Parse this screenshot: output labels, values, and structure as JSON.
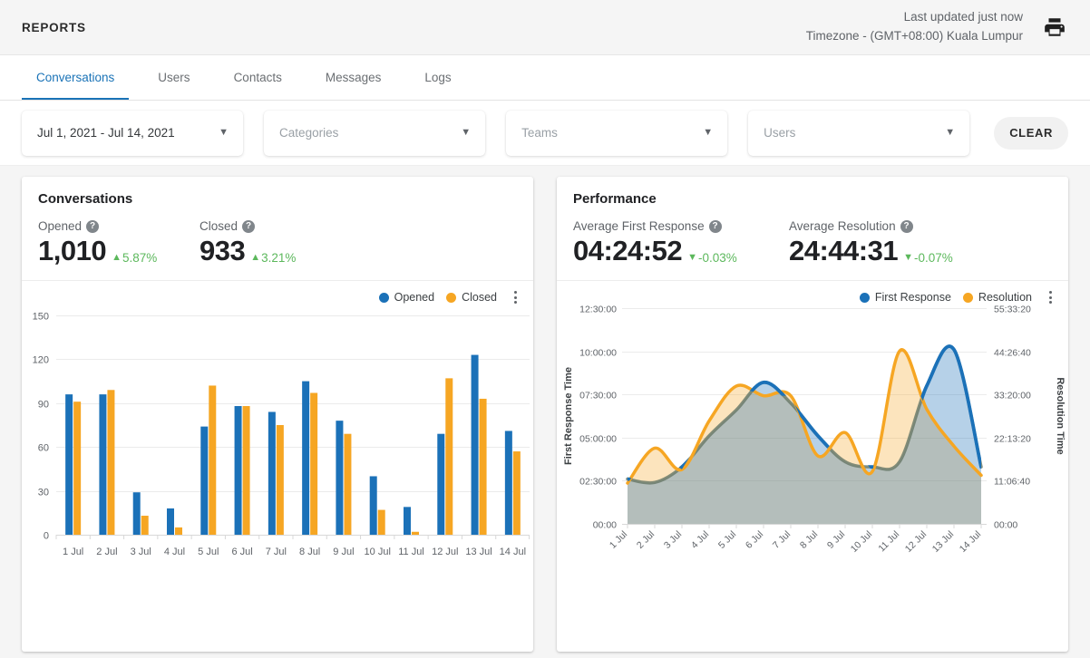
{
  "header": {
    "title": "REPORTS",
    "last_updated": "Last updated just now",
    "timezone": "Timezone - (GMT+08:00) Kuala Lumpur",
    "print_icon": "print-icon"
  },
  "tabs": [
    {
      "label": "Conversations",
      "active": true
    },
    {
      "label": "Users",
      "active": false
    },
    {
      "label": "Contacts",
      "active": false
    },
    {
      "label": "Messages",
      "active": false
    },
    {
      "label": "Logs",
      "active": false
    }
  ],
  "filters": {
    "date_range": "Jul 1, 2021 - Jul 14, 2021",
    "categories_placeholder": "Categories",
    "teams_placeholder": "Teams",
    "users_placeholder": "Users",
    "clear_label": "CLEAR",
    "chevron": "chevron-down-icon"
  },
  "conversations_card": {
    "title": "Conversations",
    "stats": [
      {
        "label": "Opened",
        "value": "1,010",
        "delta": "5.87%",
        "direction": "up"
      },
      {
        "label": "Closed",
        "value": "933",
        "delta": "3.21%",
        "direction": "up"
      }
    ],
    "legend": [
      {
        "label": "Opened",
        "color": "#1b71b8"
      },
      {
        "label": "Closed",
        "color": "#f6a623"
      }
    ]
  },
  "performance_card": {
    "title": "Performance",
    "stats": [
      {
        "label": "Average First Response",
        "value": "04:24:52",
        "delta": "-0.03%",
        "direction": "down"
      },
      {
        "label": "Average Resolution",
        "value": "24:44:31",
        "delta": "-0.07%",
        "direction": "down"
      }
    ],
    "legend": [
      {
        "label": "First Response",
        "color": "#1b71b8"
      },
      {
        "label": "Resolution",
        "color": "#f6a623"
      }
    ]
  },
  "chart_data": [
    {
      "type": "bar",
      "title": "Conversations",
      "categories": [
        "1 Jul",
        "2 Jul",
        "3 Jul",
        "4 Jul",
        "5 Jul",
        "6 Jul",
        "7 Jul",
        "8 Jul",
        "9 Jul",
        "10 Jul",
        "11 Jul",
        "12 Jul",
        "13 Jul",
        "14 Jul"
      ],
      "series": [
        {
          "name": "Opened",
          "color": "#1b71b8",
          "values": [
            96,
            96,
            29,
            18,
            74,
            88,
            84,
            105,
            78,
            40,
            19,
            69,
            123,
            71
          ]
        },
        {
          "name": "Closed",
          "color": "#f6a623",
          "values": [
            91,
            99,
            13,
            5,
            102,
            88,
            75,
            97,
            69,
            17,
            2,
            107,
            93,
            57
          ]
        }
      ],
      "xlabel": "",
      "ylabel": "",
      "ylim": [
        0,
        150
      ],
      "yticks": [
        "0",
        "30",
        "60",
        "90",
        "120",
        "150"
      ],
      "grid": true,
      "legend_position": "top-right"
    },
    {
      "type": "area",
      "title": "Performance",
      "categories": [
        "1 Jul",
        "2 Jul",
        "3 Jul",
        "4 Jul",
        "5 Jul",
        "6 Jul",
        "7 Jul",
        "8 Jul",
        "9 Jul",
        "10 Jul",
        "11 Jul",
        "12 Jul",
        "13 Jul",
        "14 Jul"
      ],
      "series": [
        {
          "name": "First Response",
          "color": "#1b71b8",
          "axis": "left",
          "yticks": [
            "00:00",
            "02:30:00",
            "05:00:00",
            "07:30:00",
            "10:00:00",
            "12:30:00"
          ],
          "values_hours": [
            2.6,
            2.4,
            3.3,
            5.1,
            6.6,
            8.2,
            7.0,
            5.1,
            3.6,
            3.3,
            3.6,
            8.0,
            10.1,
            3.3
          ]
        },
        {
          "name": "Resolution",
          "color": "#f6a623",
          "axis": "right",
          "yticks": [
            "00:00",
            "11:06:40",
            "22:13:20",
            "33:20:00",
            "44:26:40",
            "55:33:20"
          ],
          "values_hours": [
            10.5,
            19.5,
            14.0,
            26.5,
            35.5,
            33.0,
            33.0,
            17.5,
            23.5,
            13.5,
            44.5,
            29.5,
            20.0,
            12.5
          ]
        }
      ],
      "ylabel_left": "First Response Time",
      "ylabel_right": "Resolution Time",
      "grid": true,
      "legend_position": "top-right"
    }
  ]
}
